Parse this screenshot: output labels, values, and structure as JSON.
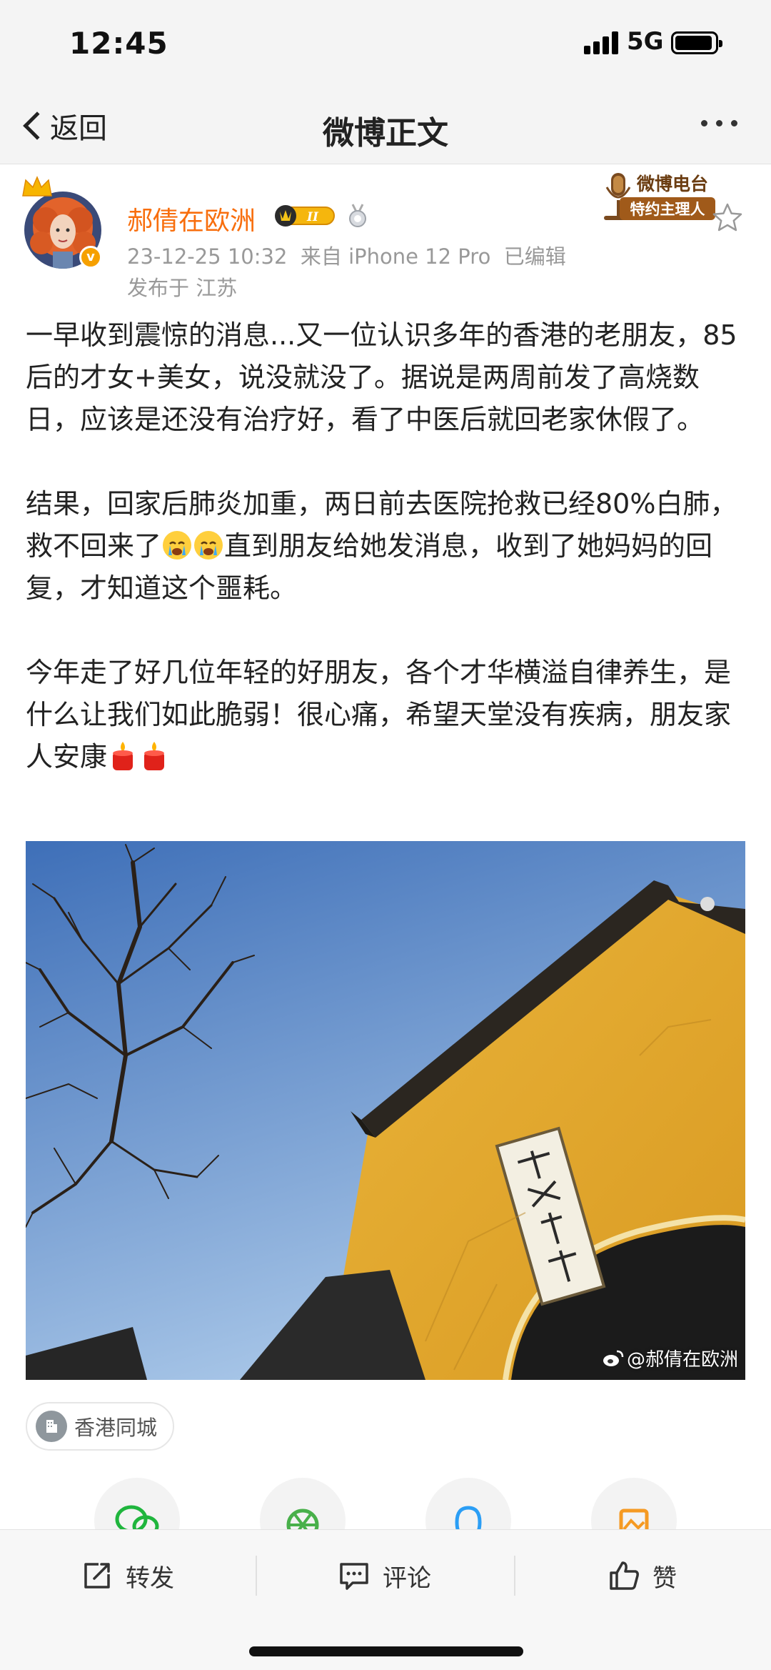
{
  "status_bar": {
    "time": "12:45",
    "network": "5G"
  },
  "nav": {
    "back_label": "返回",
    "title": "微博正文"
  },
  "author": {
    "name": "郝倩在欧洲",
    "member_level": "II",
    "meta": "23-12-25 10:32  来自 iPhone 12 Pro  已编辑",
    "location_line": "发布于 江苏"
  },
  "radio_badge": {
    "title": "微博电台",
    "subtitle": "特约主理人"
  },
  "post": {
    "paragraph1": "一早收到震惊的消息...又一位认识多年的香港的老朋友，85后的才女+美女，说没就没了。据说是两周前发了高烧数日，应该是还没有治疗好，看了中医后就回老家休假了。",
    "paragraph2_a": "结果，回家后肺炎加重，两日前去医院抢救已经80%白肺，救不回来了",
    "paragraph2_b": "直到朋友给她发消息，收到了她妈妈的回复，才知道这个噩耗。",
    "paragraph3": "今年走了好几位年轻的好朋友，各个才华横溢自律养生，是什么让我们如此脆弱！很心痛，希望天堂没有疾病，朋友家人安康",
    "image_watermark": "@郝倩在欧洲"
  },
  "location_tag": {
    "label": "香港同城"
  },
  "actions": {
    "repost": "转发",
    "comment": "评论",
    "like": "赞"
  },
  "colors": {
    "name": "#f86e0d",
    "meta": "#999999",
    "wall": "#e4ae2e",
    "sky": "#4f7fc0"
  }
}
